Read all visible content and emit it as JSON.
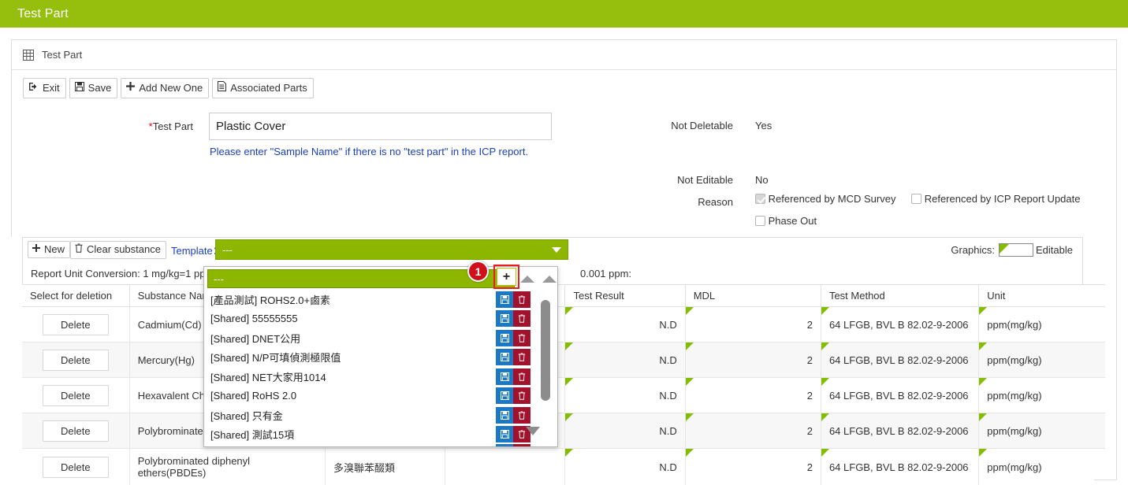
{
  "titlebar": {
    "title": "Test Part"
  },
  "panel": {
    "heading": "Test Part",
    "grid_icon": "grid-icon"
  },
  "toolbar": {
    "buttons": [
      {
        "label": "Exit",
        "icon": "exit-icon",
        "glyph": "→]"
      },
      {
        "label": "Save",
        "icon": "save-icon",
        "glyph": "💾"
      },
      {
        "label": "Add New One",
        "icon": "plus-icon",
        "glyph": "✚"
      },
      {
        "label": "Associated Parts",
        "icon": "document-icon",
        "glyph": "🗎"
      }
    ]
  },
  "form": {
    "test_part_label": "Test Part",
    "test_part_required_mark": "*",
    "test_part_value": "Plastic Cover",
    "test_part_placeholder": "",
    "hint": "Please enter \"Sample Name\" if there is no \"test part\" in the ICP report.",
    "not_deletable_label": "Not Deletable",
    "not_deletable_value": "Yes",
    "not_editable_label": "Not Editable",
    "not_editable_value": "No",
    "reason_label": "Reason",
    "reason_options": [
      {
        "label": "Referenced by MCD Survey",
        "checked": true
      },
      {
        "label": "Referenced by ICP Report Update",
        "checked": false
      },
      {
        "label": "Phase Out",
        "checked": false
      }
    ]
  },
  "substance_section": {
    "new_label": "New",
    "clear_label": "Clear substance",
    "template_label": "Template：",
    "template_selected": "---",
    "graphics_label": "Graphics:",
    "editable_label": "Editable",
    "unit_conversion_left": "Report Unit Conversion: 1 mg/kg=1 ppm",
    "unit_conversion_right": "0.001 ppm:"
  },
  "template_dropdown": {
    "search_value": "---",
    "search_placeholder": "",
    "save_icon": "save-icon",
    "delete_icon": "trash-icon",
    "items": [
      "[產品測試] ROHS2.0+鹵素",
      "[Shared] 55555555",
      "[Shared] DNET公用",
      "[Shared] N/P可填偵測極限值",
      "[Shared] NET大家用1014",
      "[Shared] RoHS 2.0",
      "[Shared] 只有金",
      "[Shared] 測試15項"
    ]
  },
  "step_marker": {
    "number": "1"
  },
  "add_button": {
    "label": "+",
    "icon": "plus-icon"
  },
  "table": {
    "columns": [
      "Select for deletion",
      "Substance Name",
      "",
      "",
      "Test Result",
      "MDL",
      "Test Method",
      "Unit"
    ],
    "delete_label": "Delete",
    "rows": [
      {
        "substance": "Cadmium(Cd)",
        "substance_cn": "",
        "extra": "",
        "test_result": "N.D",
        "mdl": "2",
        "test_method": "64 LFGB, BVL B 82.02-9-2006",
        "unit": "ppm(mg/kg)"
      },
      {
        "substance": "Mercury(Hg)",
        "substance_cn": "",
        "extra": "",
        "test_result": "N.D",
        "mdl": "2",
        "test_method": "64 LFGB, BVL B 82.02-9-2006",
        "unit": "ppm(mg/kg)"
      },
      {
        "substance": "Hexavalent Chromium(Cr6+)",
        "substance_cn": "",
        "extra": "",
        "test_result": "N.D",
        "mdl": "2",
        "test_method": "64 LFGB, BVL B 82.02-9-2006",
        "unit": "ppm(mg/kg)"
      },
      {
        "substance": "Polybrominated biphenyls(PBBs)",
        "substance_cn": "",
        "extra": "",
        "test_result": "N.D",
        "mdl": "2",
        "test_method": "64 LFGB, BVL B 82.02-9-2006",
        "unit": "ppm(mg/kg)"
      },
      {
        "substance": "Polybrominated diphenyl ethers(PBDEs)",
        "substance_cn": "多溴聯苯醊類",
        "extra": "",
        "test_result": "N.D",
        "mdl": "2",
        "test_method": "64 LFGB, BVL B 82.02-9-2006",
        "unit": "ppm(mg/kg)"
      }
    ]
  },
  "colors": {
    "brand_green": "#96bf0d",
    "select_green": "#8db600",
    "marker_green": "#84bd00",
    "link_blue": "#1b3fbb",
    "badge_red": "#d0111b",
    "icon_blue": "#1b78c4",
    "icon_red": "#a3122c"
  }
}
